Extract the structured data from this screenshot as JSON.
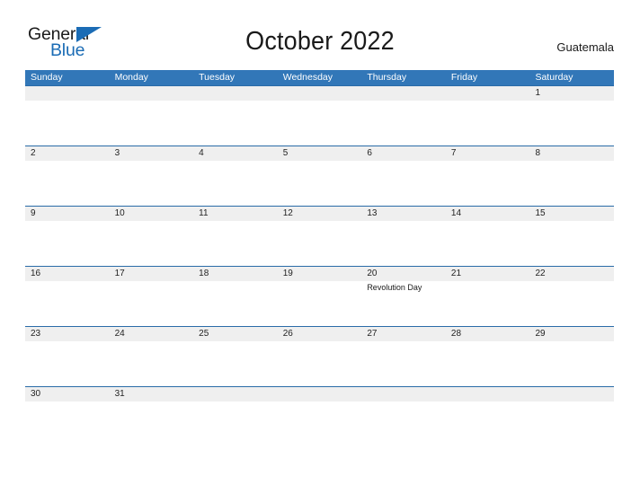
{
  "logo": {
    "word_top": "General",
    "word_bottom": "Blue",
    "flag_icon": "blue-flag-triangle-icon",
    "text_color": "#1b1b1b",
    "accent_color": "#1b6cb5"
  },
  "header": {
    "title": "October 2022",
    "country": "Guatemala"
  },
  "colors": {
    "header_blue": "#3277b8",
    "rule_blue": "#2a6ca8",
    "band_gray": "#efefef",
    "page_background": "#ffffff",
    "text": "#1a1a1a"
  },
  "calendar": {
    "weekdays": [
      "Sunday",
      "Monday",
      "Tuesday",
      "Wednesday",
      "Thursday",
      "Friday",
      "Saturday"
    ],
    "weeks": [
      {
        "days": [
          {
            "num": "",
            "event": ""
          },
          {
            "num": "",
            "event": ""
          },
          {
            "num": "",
            "event": ""
          },
          {
            "num": "",
            "event": ""
          },
          {
            "num": "",
            "event": ""
          },
          {
            "num": "",
            "event": ""
          },
          {
            "num": "1",
            "event": ""
          }
        ]
      },
      {
        "days": [
          {
            "num": "2",
            "event": ""
          },
          {
            "num": "3",
            "event": ""
          },
          {
            "num": "4",
            "event": ""
          },
          {
            "num": "5",
            "event": ""
          },
          {
            "num": "6",
            "event": ""
          },
          {
            "num": "7",
            "event": ""
          },
          {
            "num": "8",
            "event": ""
          }
        ]
      },
      {
        "days": [
          {
            "num": "9",
            "event": ""
          },
          {
            "num": "10",
            "event": ""
          },
          {
            "num": "11",
            "event": ""
          },
          {
            "num": "12",
            "event": ""
          },
          {
            "num": "13",
            "event": ""
          },
          {
            "num": "14",
            "event": ""
          },
          {
            "num": "15",
            "event": ""
          }
        ]
      },
      {
        "days": [
          {
            "num": "16",
            "event": ""
          },
          {
            "num": "17",
            "event": ""
          },
          {
            "num": "18",
            "event": ""
          },
          {
            "num": "19",
            "event": ""
          },
          {
            "num": "20",
            "event": "Revolution Day"
          },
          {
            "num": "21",
            "event": ""
          },
          {
            "num": "22",
            "event": ""
          }
        ]
      },
      {
        "days": [
          {
            "num": "23",
            "event": ""
          },
          {
            "num": "24",
            "event": ""
          },
          {
            "num": "25",
            "event": ""
          },
          {
            "num": "26",
            "event": ""
          },
          {
            "num": "27",
            "event": ""
          },
          {
            "num": "28",
            "event": ""
          },
          {
            "num": "29",
            "event": ""
          }
        ]
      },
      {
        "days": [
          {
            "num": "30",
            "event": ""
          },
          {
            "num": "31",
            "event": ""
          },
          {
            "num": "",
            "event": ""
          },
          {
            "num": "",
            "event": ""
          },
          {
            "num": "",
            "event": ""
          },
          {
            "num": "",
            "event": ""
          },
          {
            "num": "",
            "event": ""
          }
        ]
      }
    ]
  }
}
